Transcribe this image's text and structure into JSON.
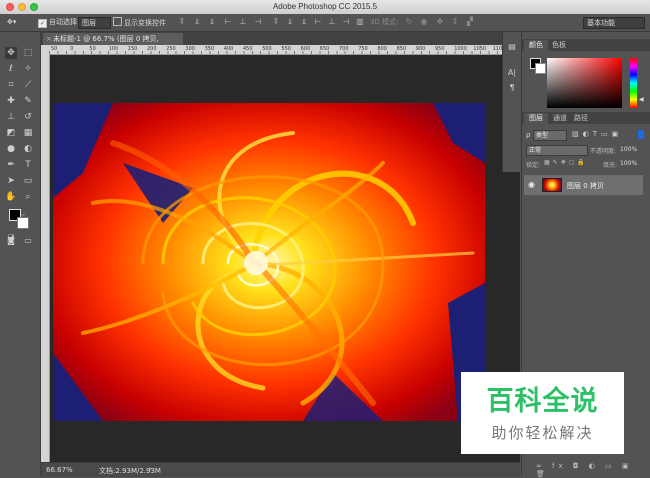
{
  "window": {
    "title": "Adobe Photoshop CC 2015.5"
  },
  "options_bar": {
    "auto_select_label": "自动选择:",
    "auto_select_value": "图层",
    "show_transform_label": "显示变换控件",
    "mode_3d_label": "3D 模式:",
    "workspace": "基本功能"
  },
  "document": {
    "tab_label": "未标题-1 @ 66.7% (图层 0 拷贝, RGB/8*) *",
    "close_icon": "×",
    "ruler_labels": [
      "50",
      "0",
      "50",
      "100",
      "150",
      "200",
      "250",
      "300",
      "350",
      "400",
      "450",
      "500",
      "550",
      "600",
      "650",
      "700",
      "750",
      "800",
      "850",
      "900",
      "950",
      "1000",
      "1050",
      "1100",
      "1150"
    ]
  },
  "status_bar": {
    "zoom": "66.67%",
    "doc_info": "文档:2.93M/2.93M"
  },
  "color_panel": {
    "tabs": [
      "颜色",
      "色板"
    ],
    "fg_color": "#000000",
    "bg_color": "#ffffff",
    "spectrum_hue": "#ff0000"
  },
  "layers_panel": {
    "tabs": [
      "图层",
      "通道",
      "路径"
    ],
    "filter_kind": "类型",
    "blend_mode": "正常",
    "opacity_label": "不透明度:",
    "opacity_value": "100%",
    "lock_label": "锁定:",
    "fill_label": "填充:",
    "fill_value": "100%",
    "layers": [
      {
        "name": "图层 0 拷贝",
        "visible": true
      }
    ]
  },
  "watermark": {
    "title": "百科全说",
    "subtitle": "助你轻松解决",
    "color": "#2dc066"
  }
}
